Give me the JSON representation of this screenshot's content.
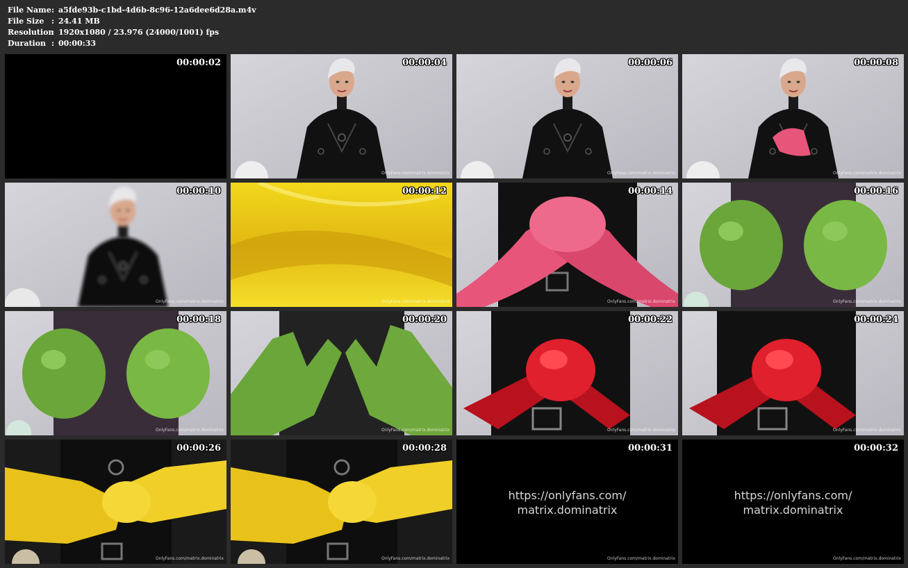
{
  "info": {
    "rows": [
      {
        "label": "File Name",
        "value": "a5fde93b-c1bd-4d6b-8c96-12a6dee6d28a.m4v"
      },
      {
        "label": "File Size",
        "value": "24.41 MB"
      },
      {
        "label": "Resolution",
        "value": "1920x1080 / 23.976 (24000/1001) fps"
      },
      {
        "label": "Duration",
        "value": "00:00:33"
      }
    ],
    "separator": ":"
  },
  "watermark": "OnlyFans.com/matrix.dominatrix",
  "thumbnails": [
    {
      "time": "00:00:02",
      "scene": "black"
    },
    {
      "time": "00:00:04",
      "scene": "portrait",
      "watermark": true
    },
    {
      "time": "00:00:06",
      "scene": "portrait",
      "watermark": true
    },
    {
      "time": "00:00:08",
      "scene": "portrait-pink",
      "watermark": true
    },
    {
      "time": "00:00:10",
      "scene": "portrait-blur",
      "watermark": true
    },
    {
      "time": "00:00:12",
      "scene": "yellow-closeup",
      "watermark": true
    },
    {
      "time": "00:00:14",
      "scene": "gloves-pink",
      "watermark": true
    },
    {
      "time": "00:00:16",
      "scene": "gloves-green-fists",
      "watermark": true
    },
    {
      "time": "00:00:18",
      "scene": "gloves-green-fists",
      "watermark": true
    },
    {
      "time": "00:00:20",
      "scene": "gloves-green-open",
      "watermark": true
    },
    {
      "time": "00:00:22",
      "scene": "gloves-red",
      "watermark": true
    },
    {
      "time": "00:00:24",
      "scene": "gloves-red",
      "watermark": true
    },
    {
      "time": "00:00:26",
      "scene": "gloves-yellow",
      "watermark": true
    },
    {
      "time": "00:00:28",
      "scene": "gloves-yellow",
      "watermark": true
    },
    {
      "time": "00:00:31",
      "scene": "url-card",
      "url_lines": [
        "https://onlyfans.com/",
        "matrix.dominatrix"
      ],
      "watermark": true
    },
    {
      "time": "00:00:32",
      "scene": "url-card",
      "url_lines": [
        "https://onlyfans.com/",
        "matrix.dominatrix"
      ],
      "watermark": true
    }
  ],
  "colors": {
    "background": "#2b2b2b",
    "text": "#ffffff",
    "studio_wall": "#c9c7cf",
    "latex_black": "#111111",
    "glove_pink": "#e8557a",
    "glove_green": "#6aa63a",
    "glove_red": "#e0202c",
    "glove_yellow": "#e8c21a"
  }
}
